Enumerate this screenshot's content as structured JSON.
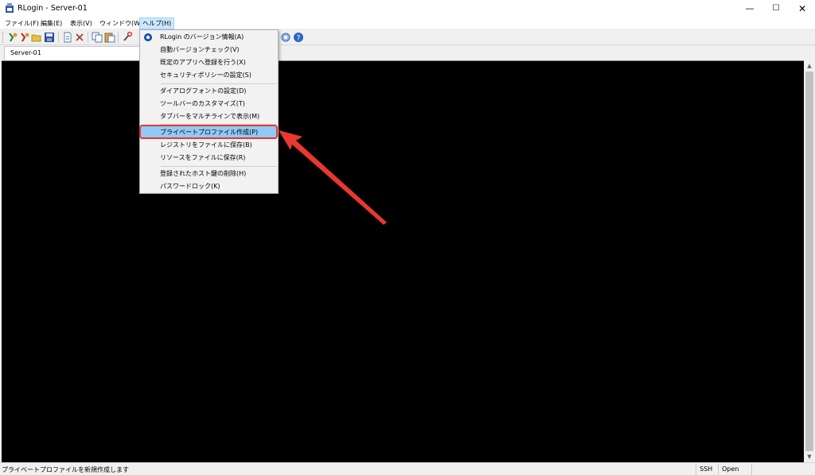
{
  "window": {
    "title": "RLogin - Server-01",
    "min_glyph": "—",
    "max_glyph": "☐",
    "close_glyph": "✕"
  },
  "menubar": {
    "items": [
      "ファイル(F)",
      "編集(E)",
      "表示(V)",
      "ウィンドウ(W)",
      "ヘルプ(H)"
    ],
    "open_index": 4
  },
  "tabs": [
    {
      "label": "Server-01"
    }
  ],
  "help_menu": {
    "items": [
      "RLogin のバージョン情報(A)",
      "自動バージョンチェック(V)",
      "既定のアプリへ登録を行う(X)",
      "セキュリティポリシーの設定(S)",
      "ダイアログフォントの設定(D)",
      "ツールバーのカスタマイズ(T)",
      "タブバーをマルチラインで表示(M)",
      "プライベートプロファイル作成(P)",
      "レジストリをファイルに保存(B)",
      "リソースをファイルに保存(R)",
      "登録されたホスト鍵の削除(H)",
      "パスワードロック(K)"
    ],
    "highlighted_index": 7
  },
  "statusbar": {
    "message": "プライベートプロファイルを新規作成します",
    "protocol": "SSH",
    "state": "Open"
  },
  "colors": {
    "highlight": "#91c9f7",
    "callout": "#e8382f",
    "terminal_bg": "#000000"
  },
  "icons": [
    "new-connection-icon",
    "reconnect-icon",
    "open-folder-icon",
    "save-icon",
    "document-icon",
    "properties-icon",
    "copy-icon",
    "paste-icon",
    "tools-icon",
    "settings-icon",
    "help-icon"
  ]
}
